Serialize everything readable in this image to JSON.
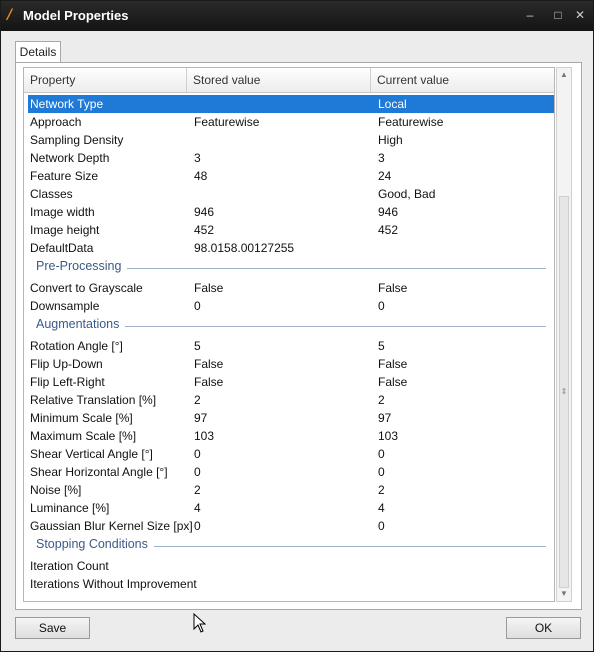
{
  "window": {
    "title": "Model Properties",
    "app_icon": "app-logo-icon",
    "controls": {
      "close": "✕",
      "minimize": "–",
      "maximize": "□"
    }
  },
  "tabs": [
    {
      "label": "Details"
    }
  ],
  "grid": {
    "columns": [
      "Property",
      "Stored value",
      "Current value"
    ],
    "rows": [
      {
        "property": "Network Type",
        "stored": "",
        "current": "Local",
        "selected": true
      },
      {
        "property": "Approach",
        "stored": "Featurewise",
        "current": "Featurewise"
      },
      {
        "property": "Sampling Density",
        "stored": "",
        "current": "High"
      },
      {
        "property": "Network Depth",
        "stored": "3",
        "current": "3"
      },
      {
        "property": "Feature Size",
        "stored": "48",
        "current": "24"
      },
      {
        "property": "Classes",
        "stored": "",
        "current": "Good, Bad"
      },
      {
        "property": "Image width",
        "stored": "946",
        "current": "946"
      },
      {
        "property": "Image height",
        "stored": "452",
        "current": "452"
      },
      {
        "property": "DefaultData",
        "stored": "98.0158.00127255",
        "current": ""
      },
      {
        "section": "Pre-Processing"
      },
      {
        "property": "Convert to Grayscale",
        "stored": "False",
        "current": "False"
      },
      {
        "property": "Downsample",
        "stored": "0",
        "current": "0"
      },
      {
        "section": "Augmentations"
      },
      {
        "property": "Rotation Angle [°]",
        "stored": "5",
        "current": "5"
      },
      {
        "property": "Flip Up-Down",
        "stored": "False",
        "current": "False"
      },
      {
        "property": "Flip Left-Right",
        "stored": "False",
        "current": "False"
      },
      {
        "property": "Relative Translation [%]",
        "stored": "2",
        "current": "2"
      },
      {
        "property": "Minimum Scale [%]",
        "stored": "97",
        "current": "97"
      },
      {
        "property": "Maximum Scale [%]",
        "stored": "103",
        "current": "103"
      },
      {
        "property": "Shear Vertical Angle [°]",
        "stored": "0",
        "current": "0"
      },
      {
        "property": "Shear Horizontal Angle [°]",
        "stored": "0",
        "current": "0"
      },
      {
        "property": "Noise [%]",
        "stored": "2",
        "current": "2"
      },
      {
        "property": "Luminance [%]",
        "stored": "4",
        "current": "4"
      },
      {
        "property": "Gaussian Blur Kernel Size [px]",
        "stored": "0",
        "current": "0"
      },
      {
        "section": "Stopping Conditions"
      },
      {
        "property": "Iteration Count",
        "stored": "",
        "current": ""
      },
      {
        "property": "Iterations Without Improvement",
        "stored": "",
        "current": ""
      }
    ]
  },
  "buttons": {
    "save": "Save",
    "ok": "OK"
  },
  "colors": {
    "selection": "#1e7ad6",
    "section_text": "#3a5a8a",
    "titlebar": "#1a1a1a",
    "app_icon": "#f08a1c"
  }
}
